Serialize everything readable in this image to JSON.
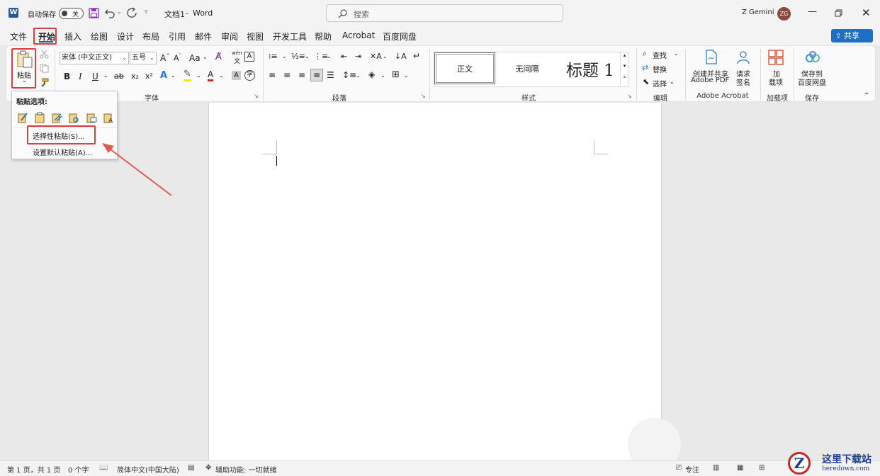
{
  "titlebar": {
    "autosave_label": "自动保存",
    "autosave_state": "关",
    "doc_title": "文档1",
    "title_sep": "-",
    "app_name": "Word",
    "search_placeholder": "搜索",
    "user_name": "Z Gemini",
    "user_initials": "ZG"
  },
  "menu": {
    "tabs": [
      "文件",
      "开始",
      "插入",
      "绘图",
      "设计",
      "布局",
      "引用",
      "邮件",
      "审阅",
      "视图",
      "开发工具",
      "帮助",
      "Acrobat",
      "百度网盘"
    ],
    "share_label": "共享"
  },
  "ribbon": {
    "paste_label": "粘贴",
    "font_name": "宋体 (中文正文)",
    "font_size": "五号",
    "case_label": "Aa",
    "wen_label": "wén",
    "format_buttons": [
      "B",
      "I",
      "U",
      "x₂",
      "x²"
    ],
    "style_normal": "正文",
    "style_nospace": "无间隔",
    "style_heading": "标题 1",
    "find_label": "查找",
    "replace_label": "替换",
    "select_label": "选择",
    "pdf_label_1": "创建并共享",
    "pdf_label_2": "Adobe PDF",
    "sign_label_1": "请求",
    "sign_label_2": "签名",
    "addin_label_1": "加",
    "addin_label_2": "载项",
    "baidu_label_1": "保存到",
    "baidu_label_2": "百度网盘",
    "groups": {
      "font": "字体",
      "paragraph": "段落",
      "styles": "样式",
      "editing": "编辑",
      "acrobat": "Adobe Acrobat",
      "addins": "加载项",
      "save": "保存"
    }
  },
  "paste_menu": {
    "title": "粘贴选项:",
    "special": "选择性粘贴(S)...",
    "default": "设置默认粘贴(A)..."
  },
  "status": {
    "page": "第 1 页，共 1 页",
    "words": "0 个字",
    "language": "简体中文(中国大陆)",
    "accessibility": "辅助功能: 一切就绪",
    "focus": "专注"
  },
  "watermark": {
    "brand": "这里下载站",
    "url": "heredown.com"
  },
  "colors": {
    "accent": "#2b579a",
    "highlight_red": "#d9413c",
    "share_blue": "#1f6fc5"
  }
}
